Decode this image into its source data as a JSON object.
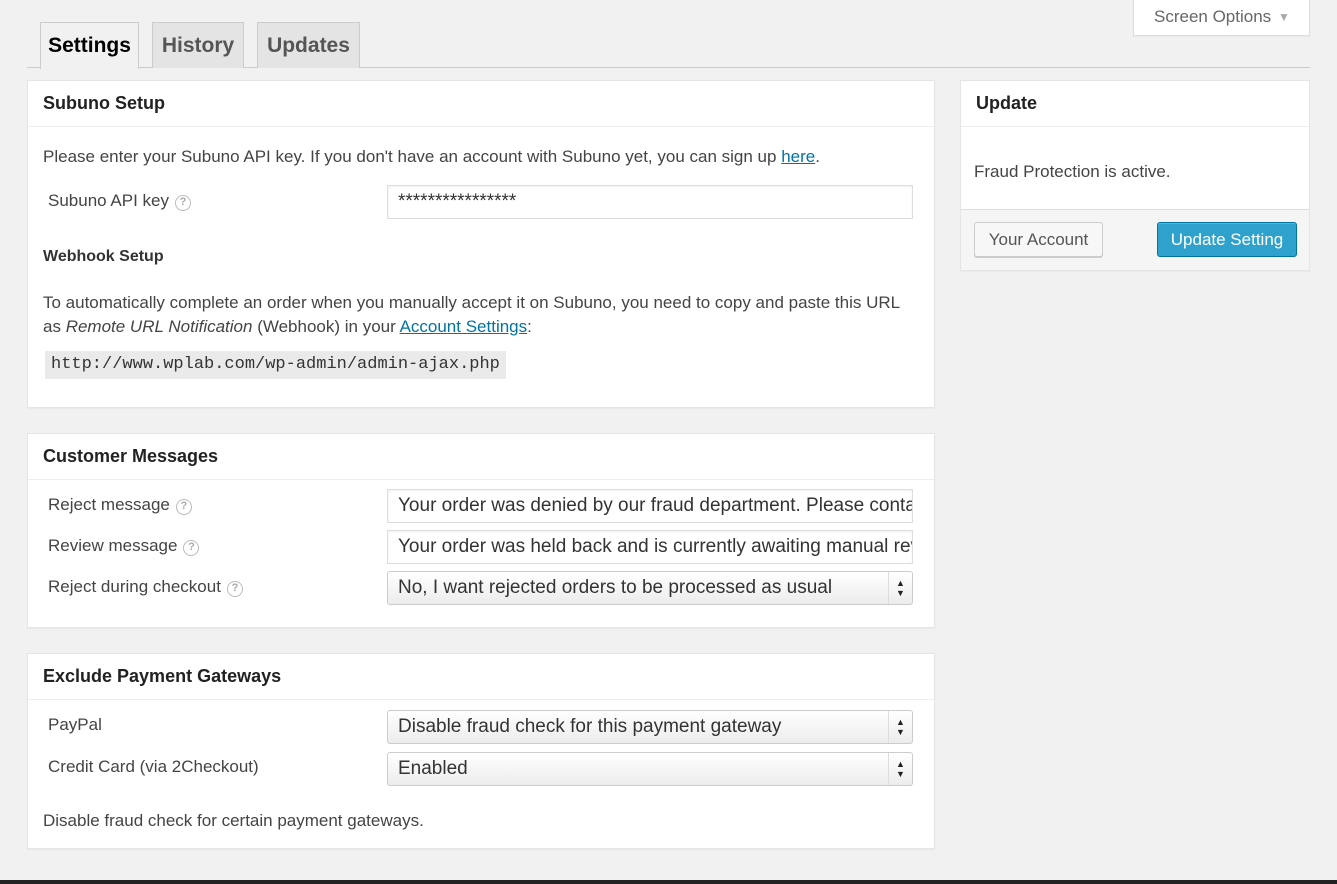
{
  "screen_options": {
    "label": "Screen Options"
  },
  "tabs": [
    {
      "label": "Settings"
    },
    {
      "label": "History"
    },
    {
      "label": "Updates"
    }
  ],
  "setup": {
    "title": "Subuno Setup",
    "intro": "Please enter your Subuno API key. If you don't have an account with Subuno yet, you can sign up ",
    "intro_link": "here",
    "intro_end": ".",
    "api_key_label": "Subuno API key",
    "api_key_value": "****************",
    "webhook_title": "Webhook Setup",
    "webhook_line1": "To automatically complete an order when you manually accept it on Subuno, you need to copy and paste this URL",
    "webhook_line2_a": "as ",
    "webhook_line2_em": "Remote URL Notification",
    "webhook_line2_b": " (Webhook) in your ",
    "webhook_line2_link": "Account Settings",
    "webhook_line2_end": ":",
    "webhook_url": "http://www.wplab.com/wp-admin/admin-ajax.php"
  },
  "messages": {
    "title": "Customer Messages",
    "reject_label": "Reject message",
    "reject_value": "Your order was denied by our fraud department. Please contact us",
    "review_label": "Review message",
    "review_value": "Your order was held back and is currently awaiting manual review",
    "checkout_label": "Reject during checkout",
    "checkout_value": "No, I want rejected orders to be processed as usual"
  },
  "gateways": {
    "title": "Exclude Payment Gateways",
    "paypal_label": "PayPal",
    "paypal_value": "Disable fraud check for this payment gateway",
    "cc_label": "Credit Card (via 2Checkout)",
    "cc_value": "Enabled",
    "note": "Disable fraud check for certain payment gateways."
  },
  "update": {
    "title": "Update",
    "status": "Fraud Protection is active.",
    "account_button": "Your Account",
    "update_button": "Update Setting"
  },
  "colors": {
    "primary": "#2ea2cc",
    "link": "#0074a2",
    "background": "#f1f1f1"
  }
}
